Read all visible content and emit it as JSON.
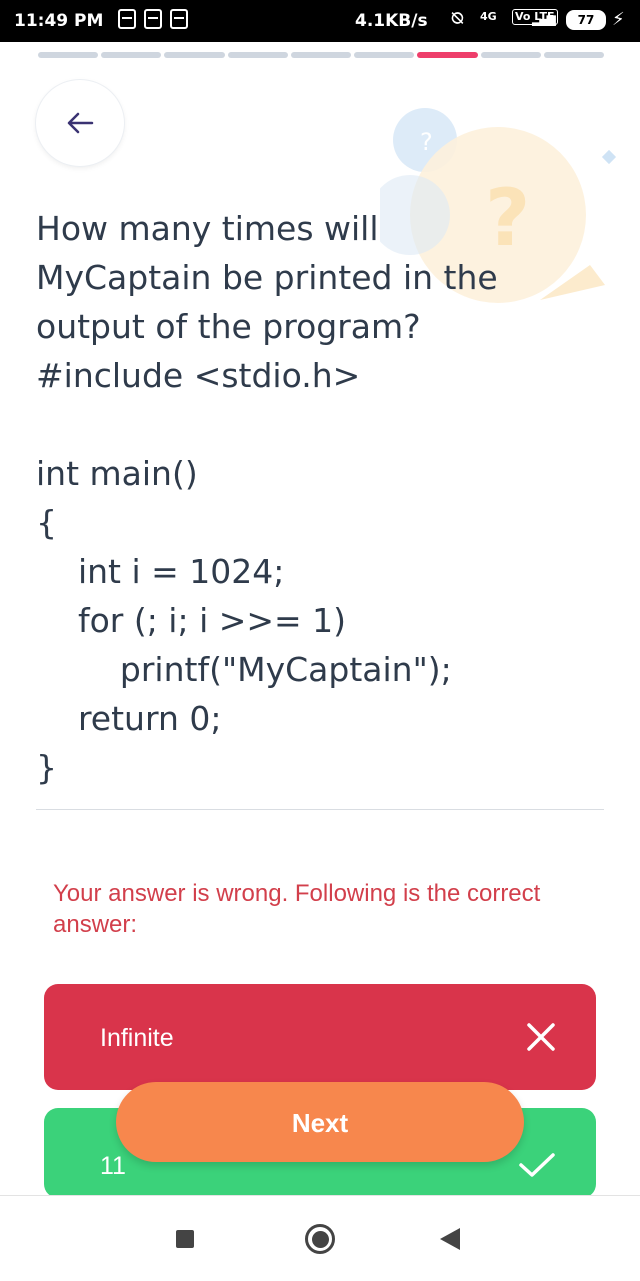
{
  "status_bar": {
    "time": "11:49 PM",
    "speed": "4.1KB/s",
    "network_1": "4G",
    "network_2": "Vo LTE",
    "battery": "77"
  },
  "progress": {
    "total_segments": 9,
    "current_segment": 7
  },
  "question": {
    "text": "How many times will\nMyCaptain be printed in the\noutput of the program?\n#include <stdio.h>\n\nint main()\n{\n    int i = 1024;\n    for (; i; i >>= 1)\n        printf(\"MyCaptain\");\n    return 0;\n}"
  },
  "result": {
    "message": "Your answer is wrong. Following is the correct answer:"
  },
  "options": {
    "selected": {
      "label": "Infinite",
      "status": "wrong"
    },
    "correct": {
      "label": "11",
      "status": "correct"
    }
  },
  "buttons": {
    "next": "Next"
  },
  "colors": {
    "accent_progress": "#ee3e6b",
    "wrong": "#d9344b",
    "correct": "#3bd27a",
    "next": "#f7874d",
    "error_text": "#d23f4b"
  }
}
